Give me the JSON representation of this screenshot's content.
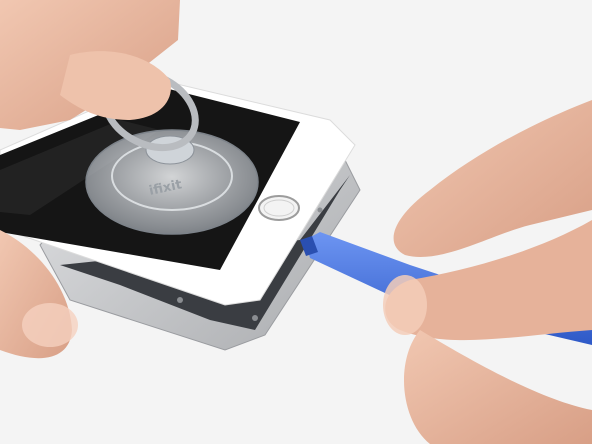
{
  "scene": {
    "background_color": "#f4f4f4",
    "phone_glass_color": "#151515",
    "phone_bezel_color": "#ffffff",
    "phone_frame_color": "#c8c9cb",
    "skin_color": "#e9b9a2",
    "pry_tool_color": "#3f6fe0",
    "suction_cup_color": "#d9dde2"
  },
  "suction_cup": {
    "brand_text": "ifixit"
  },
  "icons": [
    "suction-cup-icon",
    "home-button-icon",
    "pry-tool-icon"
  ]
}
